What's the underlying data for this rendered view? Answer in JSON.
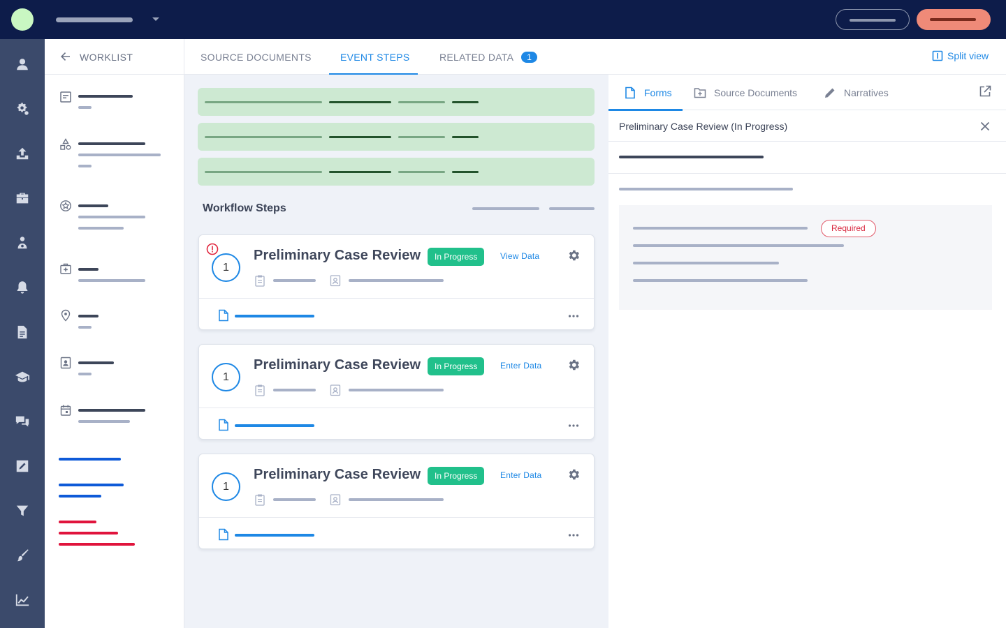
{
  "topbar": {
    "brand_color": "#0d1c4a",
    "accent_color": "#ef8a78"
  },
  "rail": {
    "icons": [
      "user-icon",
      "gears-icon",
      "upload-icon",
      "briefcase-icon",
      "people-icon",
      "bell-icon",
      "document-icon",
      "graduation-cap-icon",
      "chat-icon",
      "edit-icon",
      "filter-icon",
      "brush-icon",
      "chart-line-icon"
    ]
  },
  "sidebar": {
    "back_label": "WORKLIST"
  },
  "tabs": {
    "items": [
      {
        "label": "SOURCE DOCUMENTS"
      },
      {
        "label": "EVENT STEPS"
      },
      {
        "label": "RELATED DATA",
        "badge": "1"
      }
    ],
    "split_view_label": "Split view"
  },
  "main": {
    "workflow_title": "Workflow Steps",
    "steps": [
      {
        "number": "1",
        "title": "Preliminary Case Review",
        "status": "In Progress",
        "action": "View Data",
        "has_alert": true
      },
      {
        "number": "1",
        "title": "Preliminary Case Review",
        "status": "In Progress",
        "action": "Enter Data",
        "has_alert": false
      },
      {
        "number": "1",
        "title": "Preliminary Case Review",
        "status": "In Progress",
        "action": "Enter Data",
        "has_alert": false
      }
    ]
  },
  "panel": {
    "tabs": [
      {
        "label": "Forms",
        "icon": "file-icon"
      },
      {
        "label": "Source Documents",
        "icon": "folder-plus-icon"
      },
      {
        "label": "Narratives",
        "icon": "pencil-icon"
      }
    ],
    "header": "Preliminary Case Review (In Progress)",
    "required_label": "Required"
  },
  "colors": {
    "link": "#1e88e5",
    "status_green": "#21c08b",
    "required_red": "#d9283f"
  }
}
